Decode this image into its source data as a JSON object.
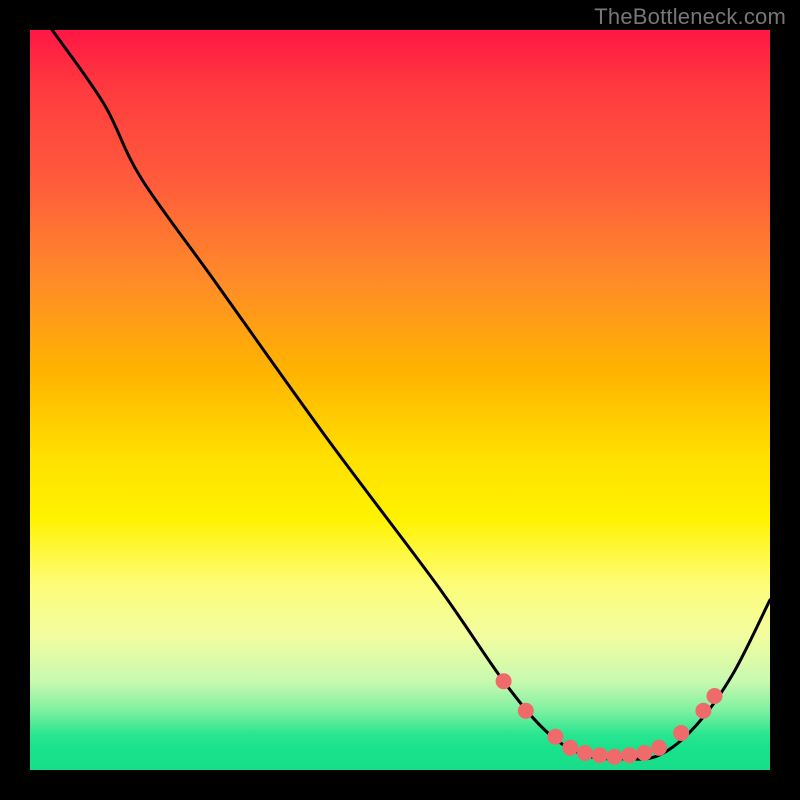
{
  "watermark": "TheBottleneck.com",
  "chart_data": {
    "type": "line",
    "title": "",
    "xlabel": "",
    "ylabel": "",
    "xlim": [
      0,
      100
    ],
    "ylim": [
      0,
      100
    ],
    "gradient_stops": [
      {
        "offset": 0,
        "color": "#ff1744"
      },
      {
        "offset": 8,
        "color": "#ff3b3f"
      },
      {
        "offset": 20,
        "color": "#ff5a3c"
      },
      {
        "offset": 34,
        "color": "#ff8c28"
      },
      {
        "offset": 46,
        "color": "#ffb300"
      },
      {
        "offset": 58,
        "color": "#ffe100"
      },
      {
        "offset": 66,
        "color": "#fff200"
      },
      {
        "offset": 75,
        "color": "#fdfd7a"
      },
      {
        "offset": 82,
        "color": "#f2fda0"
      },
      {
        "offset": 88,
        "color": "#c8f9b0"
      },
      {
        "offset": 92,
        "color": "#7ef0a0"
      },
      {
        "offset": 95,
        "color": "#2de691"
      },
      {
        "offset": 97,
        "color": "#19e28c"
      },
      {
        "offset": 100,
        "color": "#17dd8a"
      }
    ],
    "curve": [
      {
        "x": 3,
        "y": 100
      },
      {
        "x": 10,
        "y": 90
      },
      {
        "x": 15,
        "y": 80
      },
      {
        "x": 25,
        "y": 66
      },
      {
        "x": 40,
        "y": 45
      },
      {
        "x": 55,
        "y": 25
      },
      {
        "x": 64,
        "y": 12
      },
      {
        "x": 70,
        "y": 5
      },
      {
        "x": 75,
        "y": 2
      },
      {
        "x": 80,
        "y": 1.5
      },
      {
        "x": 85,
        "y": 2
      },
      {
        "x": 90,
        "y": 6
      },
      {
        "x": 95,
        "y": 13
      },
      {
        "x": 100,
        "y": 23
      }
    ],
    "markers": [
      {
        "x": 64,
        "y": 12
      },
      {
        "x": 67,
        "y": 8
      },
      {
        "x": 71,
        "y": 4.5
      },
      {
        "x": 73,
        "y": 3
      },
      {
        "x": 75,
        "y": 2.3
      },
      {
        "x": 77,
        "y": 2
      },
      {
        "x": 79,
        "y": 1.8
      },
      {
        "x": 81,
        "y": 2
      },
      {
        "x": 83,
        "y": 2.3
      },
      {
        "x": 85,
        "y": 3
      },
      {
        "x": 88,
        "y": 5
      },
      {
        "x": 91,
        "y": 8
      },
      {
        "x": 92.5,
        "y": 10
      }
    ],
    "marker_color": "#ef6b6b",
    "line_color": "#000000"
  }
}
